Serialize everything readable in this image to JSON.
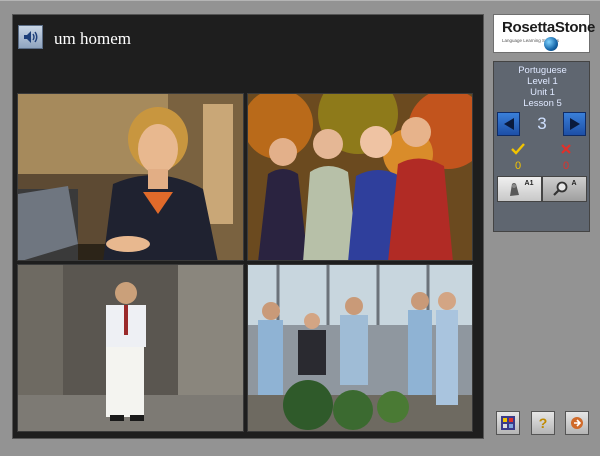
{
  "prompt": {
    "text": "um homem",
    "audio_icon": "speaker-icon"
  },
  "logo": {
    "name_rosetta": "Rosetta",
    "name_stone": "Stone",
    "tagline": "Language Learning Success"
  },
  "course": {
    "language": "Portuguese",
    "level": "Level 1",
    "unit": "Unit 1",
    "lesson": "Lesson 5"
  },
  "navigation": {
    "current_page": "3",
    "prev_icon": "left-arrow-icon",
    "next_icon": "right-arrow-icon"
  },
  "score": {
    "correct_icon": "checkmark-icon",
    "correct_count": "0",
    "wrong_icon": "x-icon",
    "wrong_count": "0"
  },
  "modes": [
    {
      "icon": "listening-icon",
      "tag": "A1"
    },
    {
      "icon": "magnifier-icon",
      "tag": "A"
    }
  ],
  "toolbar": [
    {
      "icon": "menu-icon"
    },
    {
      "icon": "help-icon",
      "label": "?"
    },
    {
      "icon": "exit-icon"
    }
  ],
  "photos": [
    {
      "subject": "woman-at-laptop"
    },
    {
      "subject": "four-women-group"
    },
    {
      "subject": "man-standing"
    },
    {
      "subject": "office-group"
    }
  ],
  "colors": {
    "panel_bg": "#5f6670",
    "stage_bg": "#1e1e1e",
    "nav_blue": "#2a66c4",
    "correct": "#f2c400",
    "wrong": "#e0302a"
  }
}
